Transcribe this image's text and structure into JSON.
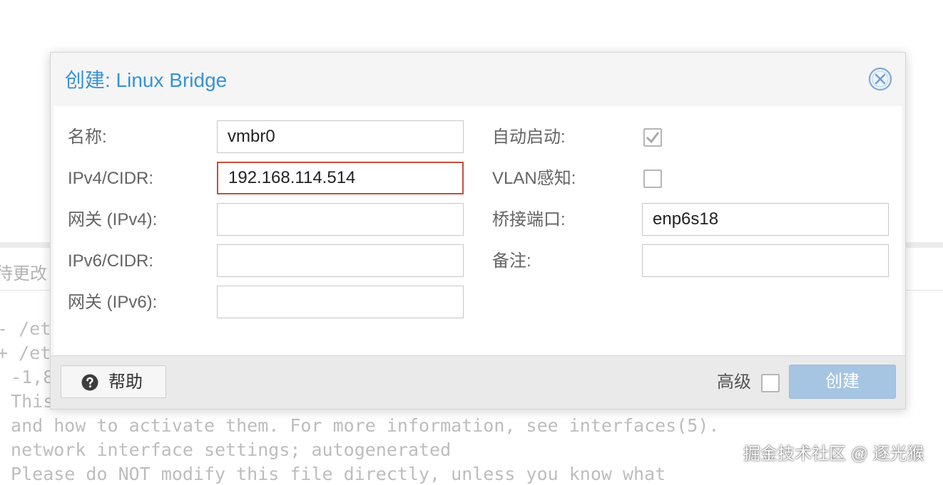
{
  "background": {
    "toolbar_text": "待更改",
    "diff_lines": [
      "- /et",
      "+ /et",
      " -1,8",
      " This",
      " and how to activate them. For more information, see interfaces(5).",
      " network interface settings; autogenerated",
      " Please do NOT modify this file directly, unless you know what"
    ],
    "watermark": "掘金技术社区 @ 逐光猴"
  },
  "dialog": {
    "title": "创建: Linux Bridge",
    "close_icon": "close-circle-icon",
    "fields": {
      "name": {
        "label": "名称:",
        "value": "vmbr0"
      },
      "ipv4_cidr": {
        "label": "IPv4/CIDR:",
        "value": "192.168.114.514",
        "invalid": true
      },
      "gateway_ipv4": {
        "label": "网关 (IPv4):",
        "value": ""
      },
      "ipv6_cidr": {
        "label": "IPv6/CIDR:",
        "value": ""
      },
      "gateway_ipv6": {
        "label": "网关 (IPv6):",
        "value": ""
      },
      "autostart": {
        "label": "自动启动:",
        "checked": true
      },
      "vlan_aware": {
        "label": "VLAN感知:",
        "checked": false
      },
      "bridge_ports": {
        "label": "桥接端口:",
        "value": "enp6s18"
      },
      "comment": {
        "label": "备注:",
        "value": ""
      }
    },
    "footer": {
      "help_label": "帮助",
      "advanced_label": "高级",
      "advanced_checked": false,
      "create_label": "创建"
    }
  },
  "colors": {
    "title": "#3892d4",
    "invalid_border": "#c0513d",
    "create_button": "#a6c5e3"
  }
}
